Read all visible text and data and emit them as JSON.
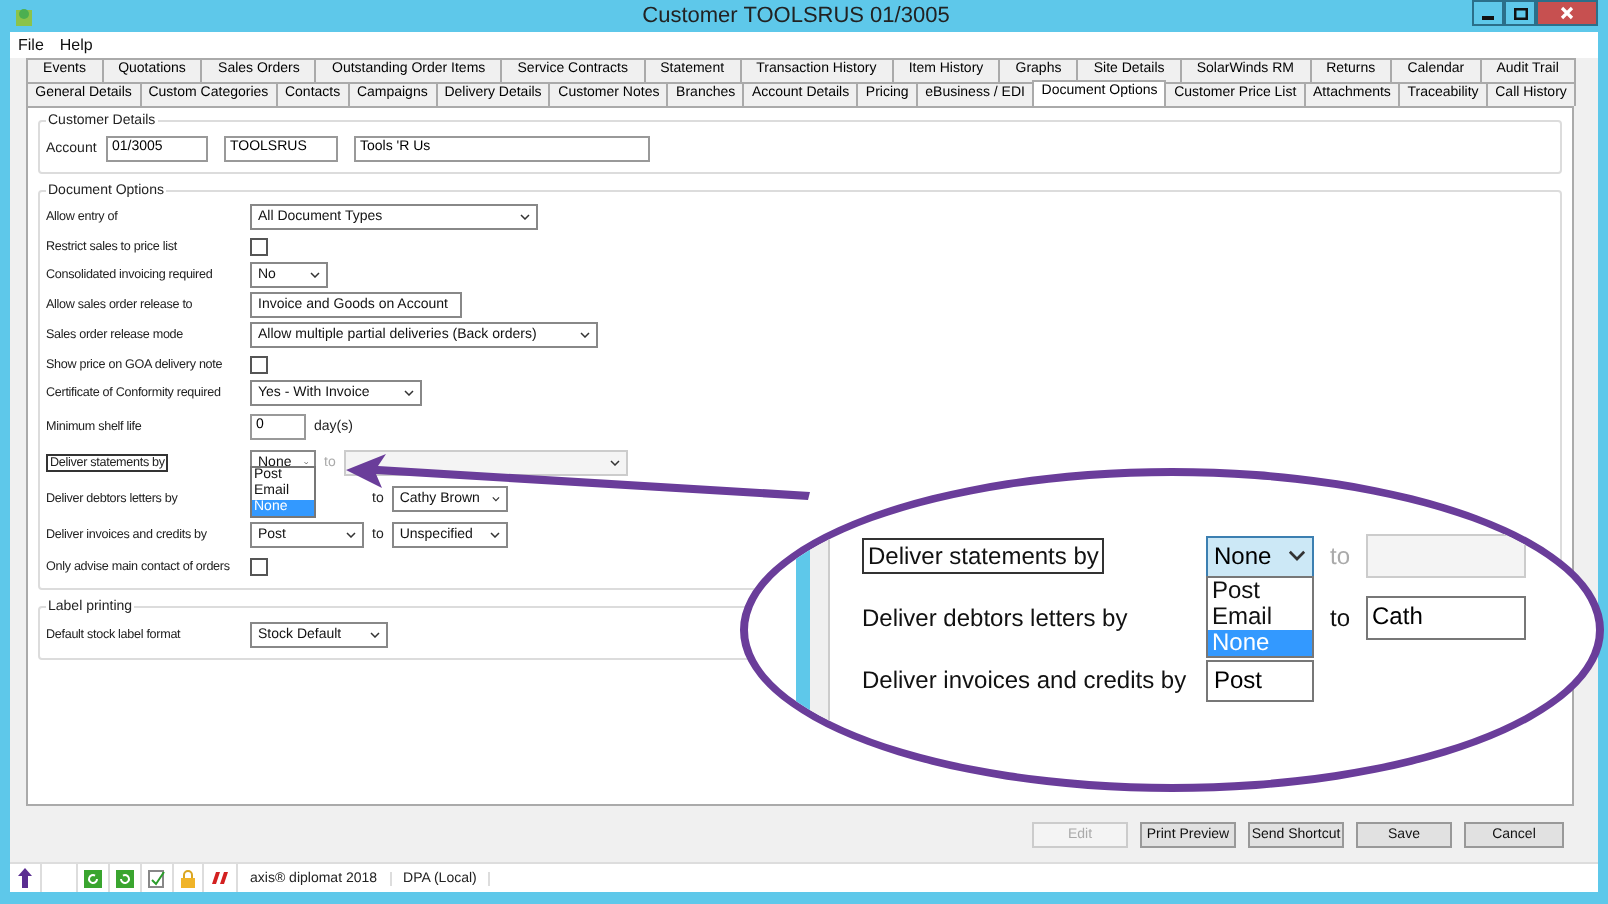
{
  "window": {
    "title": "Customer TOOLSRUS 01/3005"
  },
  "menu": [
    "File",
    "Help"
  ],
  "tab_rows": [
    [
      {
        "label": "Events",
        "selected": false
      },
      {
        "label": "Quotations",
        "selected": false
      },
      {
        "label": "Sales Orders",
        "selected": false
      },
      {
        "label": "Outstanding Order Items",
        "selected": false
      },
      {
        "label": "Service Contracts",
        "selected": false
      },
      {
        "label": "Statement",
        "selected": false
      },
      {
        "label": "Transaction History",
        "selected": false
      },
      {
        "label": "Item History",
        "selected": false
      },
      {
        "label": "Graphs",
        "selected": false
      },
      {
        "label": "Site Details",
        "selected": false
      },
      {
        "label": "SolarWinds RM",
        "selected": false
      },
      {
        "label": "Returns",
        "selected": false
      },
      {
        "label": "Calendar",
        "selected": false
      },
      {
        "label": "Audit Trail",
        "selected": false
      }
    ],
    [
      {
        "label": "General Details",
        "selected": false
      },
      {
        "label": "Custom Categories",
        "selected": false
      },
      {
        "label": "Contacts",
        "selected": false
      },
      {
        "label": "Campaigns",
        "selected": false
      },
      {
        "label": "Delivery Details",
        "selected": false
      },
      {
        "label": "Customer Notes",
        "selected": false
      },
      {
        "label": "Branches",
        "selected": false
      },
      {
        "label": "Account Details",
        "selected": false
      },
      {
        "label": "Pricing",
        "selected": false
      },
      {
        "label": "eBusiness / EDI",
        "selected": false
      },
      {
        "label": "Document Options",
        "selected": true
      },
      {
        "label": "Customer Price List",
        "selected": false
      },
      {
        "label": "Attachments",
        "selected": false
      },
      {
        "label": "Traceability",
        "selected": false
      },
      {
        "label": "Call History",
        "selected": false
      }
    ]
  ],
  "customer_details": {
    "title": "Customer Details",
    "label": "Account",
    "fields": [
      "01/3005",
      "TOOLSRUS",
      "Tools 'R Us"
    ]
  },
  "document_options": {
    "title": "Document Options",
    "rows": [
      {
        "kind": "select",
        "label": "Allow entry of",
        "value": "All Document Types"
      },
      {
        "kind": "checkbox",
        "label": "Restrict sales to price list",
        "checked": false
      },
      {
        "kind": "select",
        "label": "Consolidated invoicing required",
        "value": "No"
      },
      {
        "kind": "select",
        "label": "Allow sales order release to",
        "value": "Invoice and Goods on Account"
      },
      {
        "kind": "select",
        "label": "Sales order release mode",
        "value": "Allow multiple partial deliveries (Back orders)"
      },
      {
        "kind": "checkbox",
        "label": "Show price on GOA delivery note",
        "checked": false
      },
      {
        "kind": "select",
        "label": "Certificate of Conformity required",
        "value": "Yes - With Invoice"
      },
      {
        "kind": "number",
        "label": "Minimum shelf life",
        "value": "0",
        "unit": "day(s)"
      },
      {
        "kind": "delivery",
        "label": "Deliver statements by",
        "focused": true,
        "value": "None",
        "to": "to",
        "target": "",
        "target_disabled": true,
        "open": true,
        "options": [
          {
            "label": "Post",
            "selected": false
          },
          {
            "label": "Email",
            "selected": false
          },
          {
            "label": "None",
            "selected": true
          }
        ]
      },
      {
        "kind": "delivery",
        "label": "Deliver debtors letters by",
        "focused": false,
        "to": "to",
        "target": "Cathy Brown",
        "target_disabled": false
      },
      {
        "kind": "delivery",
        "label": "Deliver invoices and credits by",
        "focused": false,
        "value": "Post",
        "to": "to",
        "target": "Unspecified",
        "target_disabled": false
      },
      {
        "kind": "checkbox",
        "label": "Only advise main contact of orders",
        "checked": false
      }
    ]
  },
  "label_printing": {
    "title": "Label printing",
    "label": "Default stock label format",
    "value": "Stock Default"
  },
  "buttons": [
    {
      "label": "Edit",
      "disabled": true
    },
    {
      "label": "Print Preview",
      "disabled": false
    },
    {
      "label": "Send Shortcut",
      "disabled": false
    },
    {
      "label": "Save",
      "disabled": false
    },
    {
      "label": "Cancel",
      "disabled": false
    }
  ],
  "status_bar": {
    "product": "axis® diplomat 2018",
    "database": "DPA (Local)"
  },
  "callout": {
    "rows": [
      {
        "label": "Deliver statements by",
        "focused": true,
        "value": "None",
        "to": "to",
        "options": [
          {
            "label": "Post",
            "selected": false
          },
          {
            "label": "Email",
            "selected": false
          },
          {
            "label": "None",
            "selected": true
          }
        ]
      },
      {
        "label": "Deliver debtors letters by",
        "focused": false,
        "to": "to",
        "target": "Cath"
      },
      {
        "label": "Deliver invoices and credits by",
        "focused": false,
        "value": "Post"
      }
    ]
  }
}
